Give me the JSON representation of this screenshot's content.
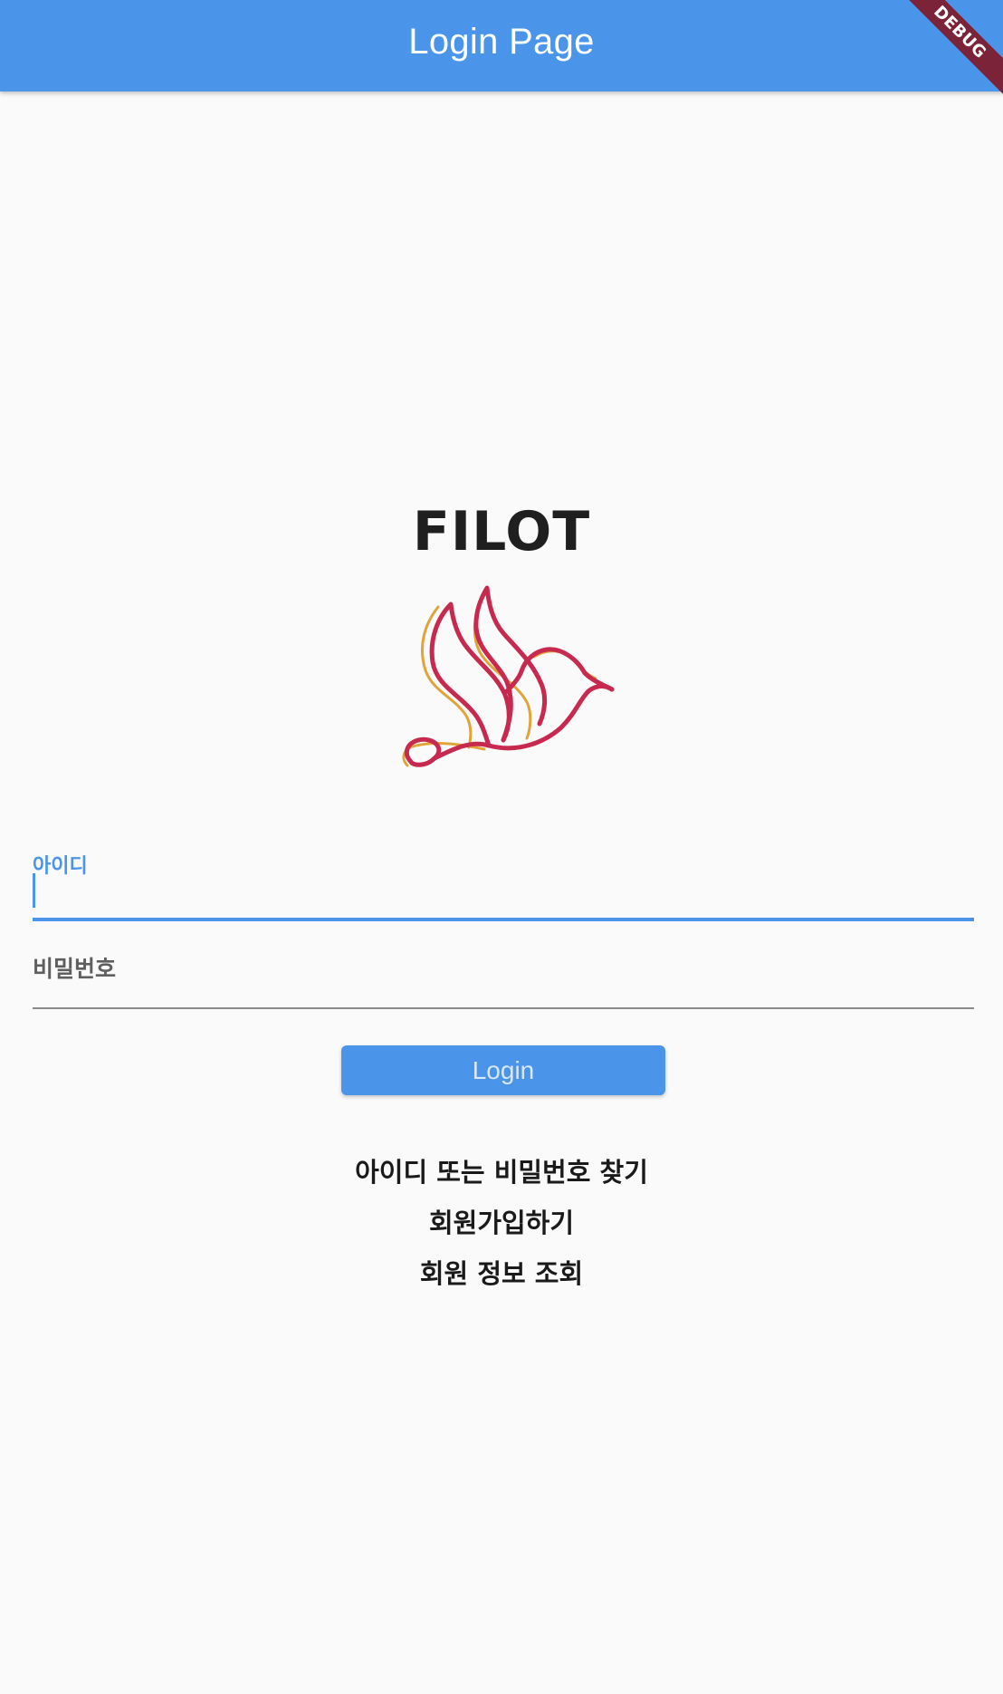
{
  "appbar": {
    "title": "Login Page",
    "color": "#4a94e9"
  },
  "debug_banner": {
    "label": "DEBUG"
  },
  "brand": {
    "name": "FILOT",
    "logo_icon": "bird-logo-icon"
  },
  "form": {
    "id_field": {
      "label": "아이디",
      "value": ""
    },
    "password_field": {
      "label": "비밀번호",
      "value": ""
    },
    "login_button_label": "Login"
  },
  "links": {
    "find_account": "아이디 또는 비밀번호 찾기",
    "signup": "회원가입하기",
    "member_info": "회원 정보 조회"
  }
}
